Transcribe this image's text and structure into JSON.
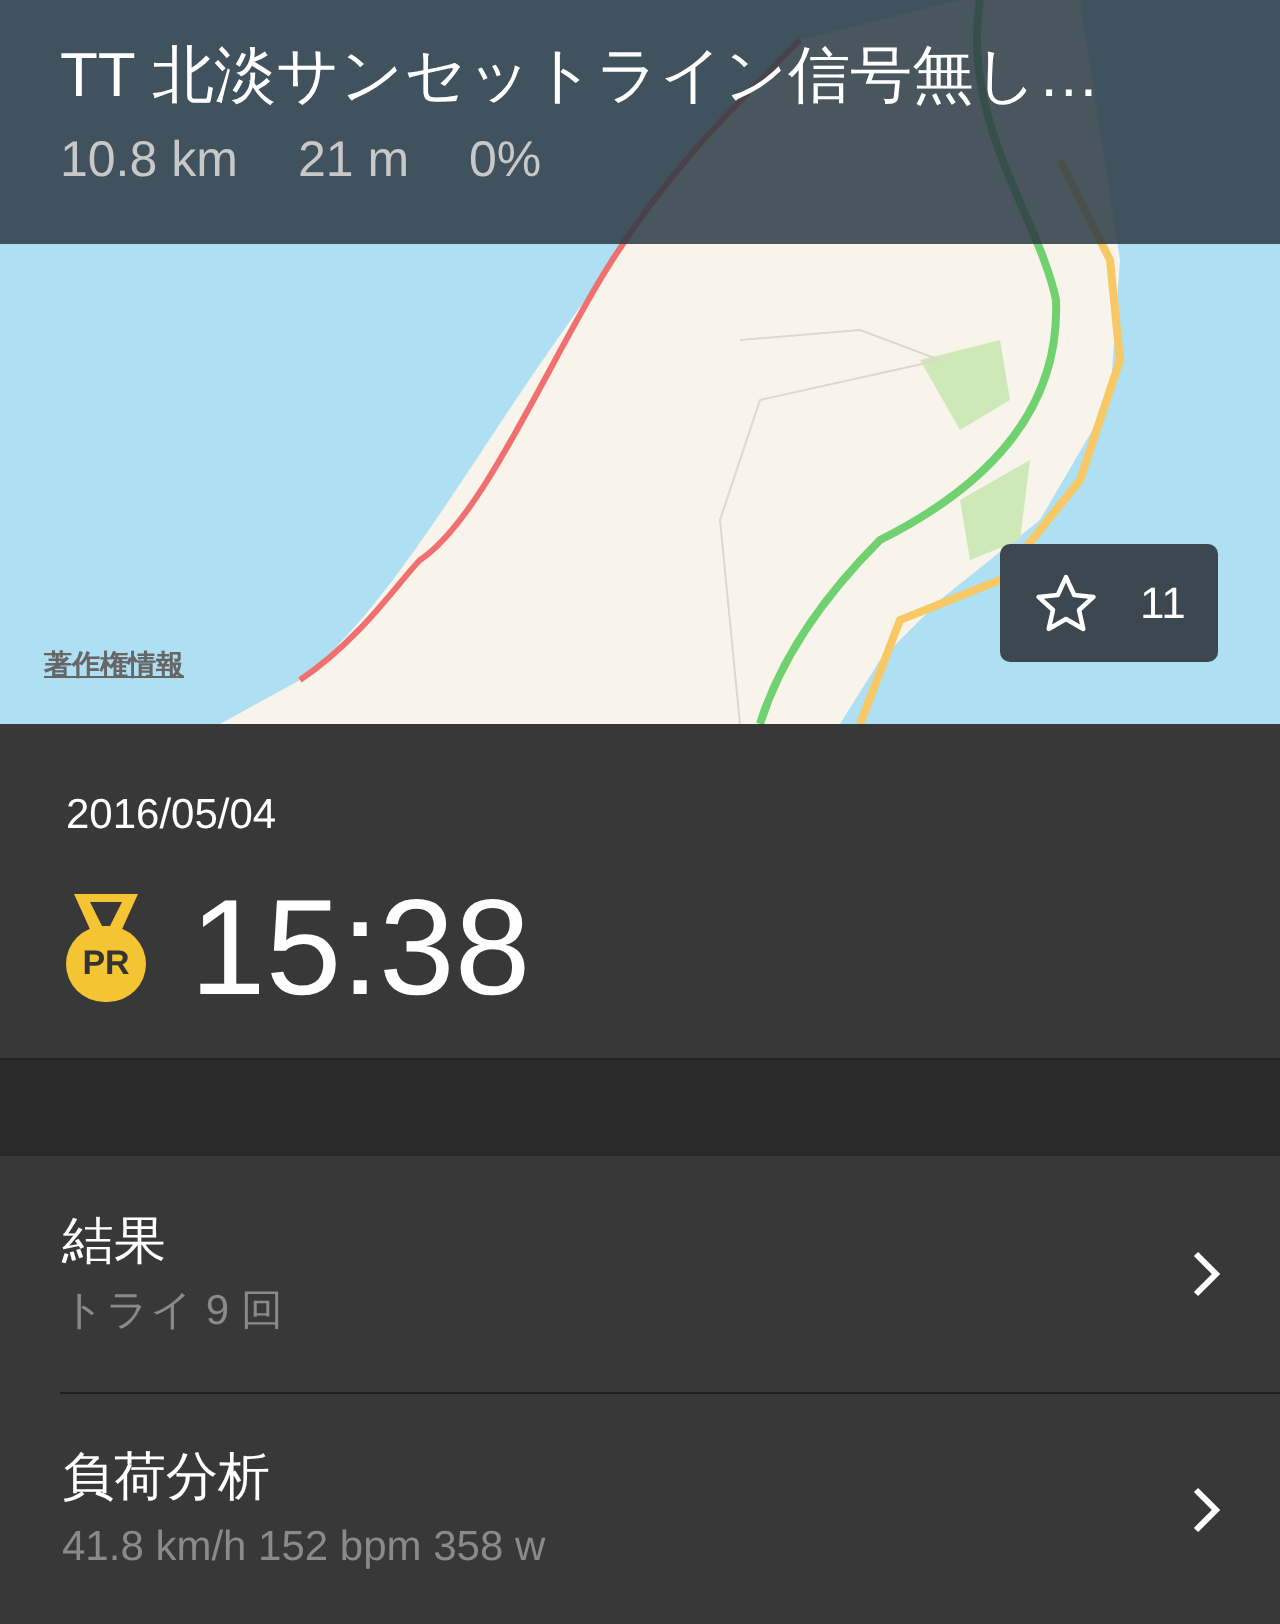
{
  "header": {
    "title": "TT 北淡サンセットライン信号無し…",
    "stats": [
      "10.8 km",
      "21 m",
      "0%"
    ]
  },
  "map": {
    "legal_link": "著作権情報",
    "favorite": {
      "count": "11"
    }
  },
  "summary": {
    "date": "2016/05/04",
    "badge": "PR",
    "time": "15:38"
  },
  "rows": [
    {
      "title": "結果",
      "subtitle": "トライ 9 回"
    },
    {
      "title": "負荷分析",
      "subtitle": "41.8 km/h 152 bpm 358 w"
    }
  ]
}
